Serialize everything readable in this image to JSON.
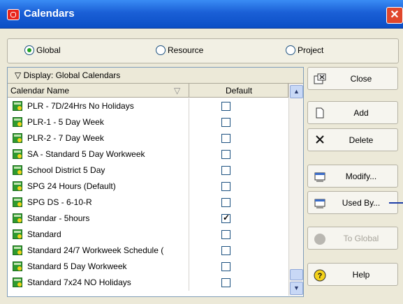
{
  "window": {
    "title": "Calendars"
  },
  "scope": {
    "options": [
      {
        "label": "Global",
        "selected": true
      },
      {
        "label": "Resource",
        "selected": false
      },
      {
        "label": "Project",
        "selected": false
      }
    ]
  },
  "grid": {
    "display_label": "Display: Global Calendars",
    "columns": {
      "name": "Calendar Name",
      "default": "Default"
    },
    "rows": [
      {
        "name": "PLR - 7D/24Hrs No Holidays",
        "default": false
      },
      {
        "name": "PLR-1 - 5 Day Week",
        "default": false
      },
      {
        "name": "PLR-2 - 7 Day Week",
        "default": false
      },
      {
        "name": "SA - Standard 5 Day Workweek",
        "default": false
      },
      {
        "name": "School District 5 Day",
        "default": false
      },
      {
        "name": "SPG 24 Hours (Default)",
        "default": false
      },
      {
        "name": "SPG DS - 6-10-R",
        "default": false
      },
      {
        "name": "Standar - 5hours",
        "default": true
      },
      {
        "name": "Standard",
        "default": false
      },
      {
        "name": "Standard 24/7 Workweek Schedule (",
        "default": false
      },
      {
        "name": "Standard 5 Day Workweek",
        "default": false
      },
      {
        "name": "Standard 7x24 NO Holidays",
        "default": false
      }
    ]
  },
  "buttons": {
    "close": "Close",
    "add": "Add",
    "delete": "Delete",
    "modify": "Modify...",
    "used_by": "Used By...",
    "to_global": "To Global",
    "help": "Help"
  },
  "icons": {
    "close_button": "close-window-icon",
    "add_button": "new-document-icon",
    "delete_button": "delete-x-icon",
    "modify_button": "modify-calendar-icon",
    "used_by_button": "used-by-icon",
    "to_global_button": "to-global-icon",
    "help_button": "help-icon",
    "calendar_row": "calendar-icon"
  },
  "colors": {
    "title_bar": "#1a5fd6",
    "accent_green": "#2f9a2f",
    "radio_selected": "#21a121"
  }
}
